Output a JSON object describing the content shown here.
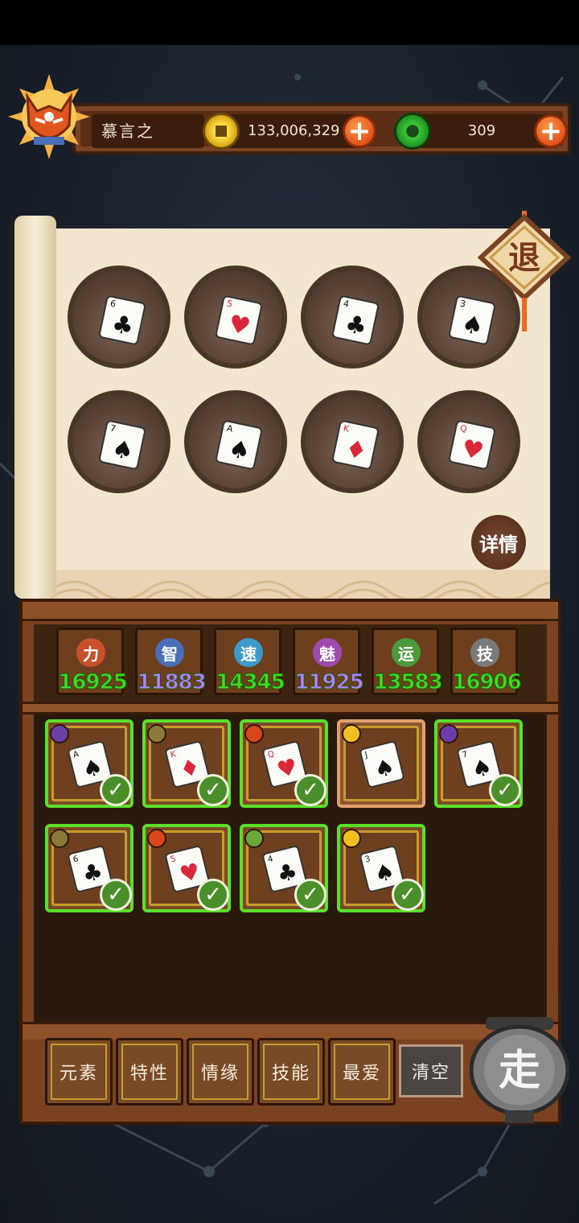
{
  "player": {
    "name": "慕言之"
  },
  "currency": {
    "coins": "133,006,329",
    "jade": "309"
  },
  "buttons": {
    "exit": "退",
    "detail": "详情",
    "clear": "清空",
    "go": "走"
  },
  "slots": [
    {
      "rank": "6",
      "suit": "clubs"
    },
    {
      "rank": "5",
      "suit": "hearts"
    },
    {
      "rank": "4",
      "suit": "clubs"
    },
    {
      "rank": "3",
      "suit": "spades"
    },
    {
      "rank": "7",
      "suit": "spades"
    },
    {
      "rank": "A",
      "suit": "spades"
    },
    {
      "rank": "K",
      "suit": "diamonds"
    },
    {
      "rank": "Q",
      "suit": "hearts"
    }
  ],
  "stats": [
    {
      "label": "力",
      "value": "16925",
      "color": "#c8502a"
    },
    {
      "label": "智",
      "value": "11883",
      "color": "#4a6fb8"
    },
    {
      "label": "速",
      "value": "14345",
      "color": "#3a9ac8"
    },
    {
      "label": "魅",
      "value": "11925",
      "color": "#a04ab0"
    },
    {
      "label": "运",
      "value": "13583",
      "color": "#4a9a3a"
    },
    {
      "label": "技",
      "value": "16906",
      "color": "#7a7a7a"
    }
  ],
  "stat_value_colors": [
    "#3fd822",
    "#b080ff",
    "#3fd822",
    "#b080ff",
    "#3fd822",
    "#3fd822"
  ],
  "cards": [
    {
      "rank": "A",
      "suit": "spades",
      "element": "moon",
      "selected": true
    },
    {
      "rank": "K",
      "suit": "diamonds",
      "element": "earth",
      "selected": true
    },
    {
      "rank": "Q",
      "suit": "hearts",
      "element": "fire",
      "selected": true
    },
    {
      "rank": "J",
      "suit": "spades",
      "element": "sun",
      "selected": false
    },
    {
      "rank": "7",
      "suit": "spades",
      "element": "moon",
      "selected": true
    },
    {
      "rank": "6",
      "suit": "clubs",
      "element": "earth",
      "selected": true
    },
    {
      "rank": "5",
      "suit": "hearts",
      "element": "fire",
      "selected": true
    },
    {
      "rank": "4",
      "suit": "clubs",
      "element": "leaf",
      "selected": true
    },
    {
      "rank": "3",
      "suit": "spades",
      "element": "sun",
      "selected": true
    }
  ],
  "element_colors": {
    "moon": "#6a3fa8",
    "earth": "#8a7a3a",
    "fire": "#d8461a",
    "sun": "#f0c020",
    "leaf": "#6aa83a"
  },
  "tabs": [
    "元素",
    "特性",
    "情缘",
    "技能",
    "最爱"
  ]
}
